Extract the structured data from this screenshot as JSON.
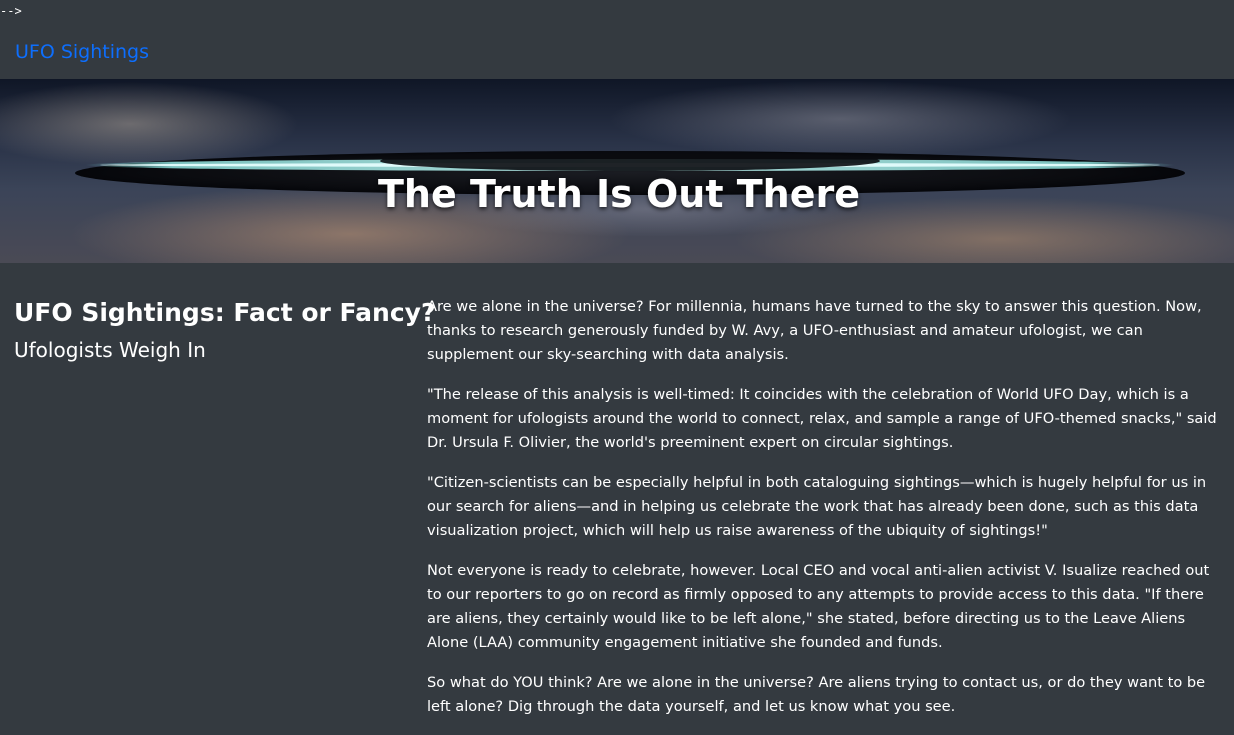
{
  "stray_text": "-->",
  "navbar": {
    "brand": "UFO Sightings"
  },
  "hero": {
    "title": "The Truth Is Out There"
  },
  "sidebar": {
    "title": "UFO Sightings: Fact or Fancy?",
    "subtitle": "Ufologists Weigh In"
  },
  "article": {
    "paragraphs": [
      "Are we alone in the universe? For millennia, humans have turned to the sky to answer this question. Now, thanks to research generously funded by W. Avy, a UFO-enthusiast and amateur ufologist, we can supplement our sky-searching with data analysis.",
      "\"The release of this analysis is well-timed: It coincides with the celebration of World UFO Day, which is a moment for ufologists around the world to connect, relax, and sample a range of UFO-themed snacks,\" said Dr. Ursula F. Olivier, the world's preeminent expert on circular sightings.",
      "\"Citizen-scientists can be especially helpful in both cataloguing sightings—which is hugely helpful for us in our search for aliens—and in helping us celebrate the work that has already been done, such as this data visualization project, which will help us raise awareness of the ubiquity of sightings!\"",
      "Not everyone is ready to celebrate, however. Local CEO and vocal anti-alien activist V. Isualize reached out to our reporters to go on record as firmly opposed to any attempts to provide access to this data. \"If there are aliens, they certainly would like to be left alone,\" she stated, before directing us to the Leave Aliens Alone (LAA) community engagement initiative she founded and funds.",
      "So what do YOU think? Are we alone in the universe? Are aliens trying to contact us, or do they want to be left alone? Dig through the data yourself, and let us know what you see."
    ]
  },
  "colors": {
    "background": "#343a40",
    "brand_link": "#0d6efd",
    "ufo_glow": "#7ff3f0"
  }
}
